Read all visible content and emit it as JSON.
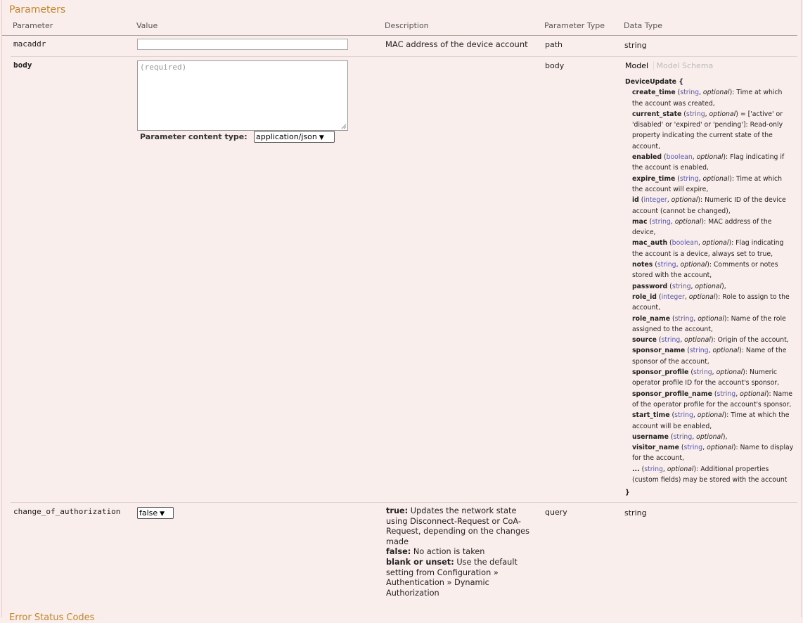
{
  "section_title": "Parameters",
  "columns": [
    "Parameter",
    "Value",
    "Description",
    "Parameter Type",
    "Data Type"
  ],
  "rows": {
    "macaddr": {
      "name": "macaddr",
      "value": "",
      "description": "MAC address of the device account",
      "param_type": "path",
      "data_type": "string"
    },
    "body": {
      "name": "body",
      "placeholder": "(required)",
      "content_type_label": "Parameter content type:",
      "content_type_value": "application/json",
      "param_type": "body",
      "model_tab": "Model",
      "model_schema_tab": "Model Schema"
    },
    "cta": {
      "name": "change_of_authorization",
      "value": "false",
      "true_label": "true:",
      "true_text": "Updates the network state using Disconnect-Request or CoA-Request, depending on the changes made",
      "false_label": "false:",
      "false_text": "No action is taken",
      "blank_label": "blank or unset:",
      "blank_text": "Use the default setting from Configuration » Authentication » Dynamic Authorization",
      "param_type": "query",
      "data_type": "string"
    }
  },
  "schema": {
    "title": "DeviceUpdate {",
    "close": "}",
    "properties": [
      {
        "name": "create_time",
        "type": "string",
        "opt": "optional",
        "desc": ": Time at which the account was created,"
      },
      {
        "name": "current_state",
        "type": "string",
        "opt": "optional",
        "desc": " = ['active' or 'disabled' or 'expired' or 'pending']: Read-only property indicating the current state of the account,"
      },
      {
        "name": "enabled",
        "type": "boolean",
        "opt": "optional",
        "desc": ": Flag indicating if the account is enabled,"
      },
      {
        "name": "expire_time",
        "type": "string",
        "opt": "optional",
        "desc": ": Time at which the account will expire,"
      },
      {
        "name": "id",
        "type": "integer",
        "opt": "optional",
        "desc": ": Numeric ID of the device account (cannot be changed),"
      },
      {
        "name": "mac",
        "type": "string",
        "opt": "optional",
        "desc": ": MAC address of the device,"
      },
      {
        "name": "mac_auth",
        "type": "boolean",
        "opt": "optional",
        "desc": ": Flag indicating the account is a device, always set to true,"
      },
      {
        "name": "notes",
        "type": "string",
        "opt": "optional",
        "desc": ": Comments or notes stored with the account,"
      },
      {
        "name": "password",
        "type": "string",
        "opt": "optional",
        "desc": ","
      },
      {
        "name": "role_id",
        "type": "integer",
        "opt": "optional",
        "desc": ": Role to assign to the account,"
      },
      {
        "name": "role_name",
        "type": "string",
        "opt": "optional",
        "desc": ": Name of the role assigned to the account,"
      },
      {
        "name": "source",
        "type": "string",
        "opt": "optional",
        "desc": ": Origin of the account,"
      },
      {
        "name": "sponsor_name",
        "type": "string",
        "opt": "optional",
        "desc": ": Name of the sponsor of the account,"
      },
      {
        "name": "sponsor_profile",
        "type": "string",
        "opt": "optional",
        "desc": ": Numeric operator profile ID for the account's sponsor,"
      },
      {
        "name": "sponsor_profile_name",
        "type": "string",
        "opt": "optional",
        "desc": ": Name of the operator profile for the account's sponsor,"
      },
      {
        "name": "start_time",
        "type": "string",
        "opt": "optional",
        "desc": ": Time at which the account will be enabled,"
      },
      {
        "name": "username",
        "type": "string",
        "opt": "optional",
        "desc": ","
      },
      {
        "name": "visitor_name",
        "type": "string",
        "opt": "optional",
        "desc": ": Name to display for the account,"
      },
      {
        "name": "...",
        "type": "string",
        "opt": "optional",
        "desc": ": Additional properties (custom fields) may be stored with the account"
      }
    ]
  },
  "footer_partial": "Error Status Codes",
  "icons": {
    "select_chevron": "chevron-down-icon",
    "resize_handle": "resize-grip-icon"
  }
}
